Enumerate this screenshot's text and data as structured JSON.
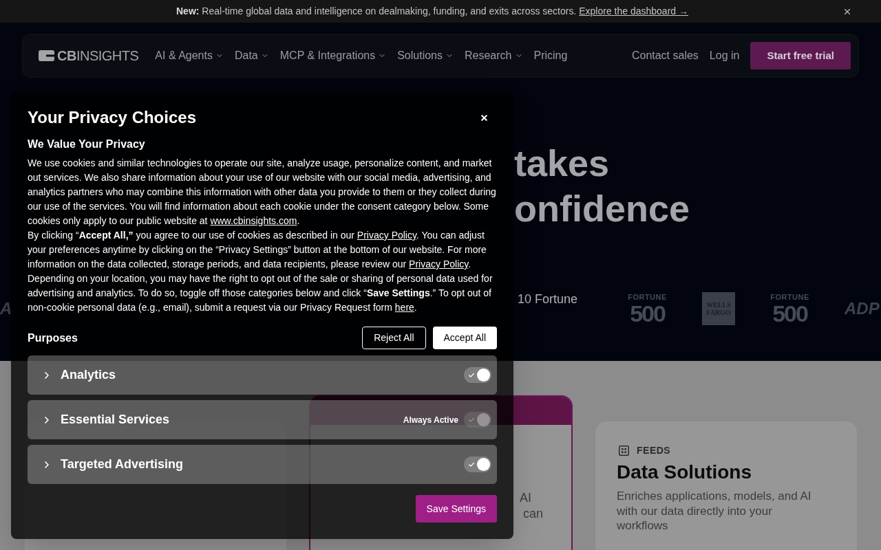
{
  "announcement": {
    "text": "**New:** Real-time global data and intelligence on dealmaking, funding, and exits across sectors.",
    "link": "Explore the dashboard →"
  },
  "nav": {
    "logo": "**CB**INSIGHTS",
    "items": [
      {
        "label": "AI & Agents",
        "kind": "menu"
      },
      {
        "label": "Data",
        "kind": "menu"
      },
      {
        "label": "MCP & Integrations",
        "kind": "menu"
      },
      {
        "label": "Solutions",
        "kind": "menu"
      },
      {
        "label": "Research",
        "kind": "menu"
      },
      {
        "label": "Pricing",
        "kind": "link"
      }
    ],
    "actions": [
      {
        "label": "Contact sales",
        "kind": "link"
      },
      {
        "label": "Log in",
        "kind": "link"
      },
      {
        "label": "Start free trial",
        "kind": "primary"
      }
    ]
  },
  "hero": {
    "heading_fragments": [
      "takes",
      "onfidence"
    ],
    "caption_fragment": "10 Fortune",
    "logos": [
      {
        "kind": "adp",
        "lines": [
          "A"
        ]
      },
      {
        "kind": "fortune",
        "lines": [
          "FORTUNE",
          "500"
        ]
      },
      {
        "kind": "wells_fargo",
        "lines": [
          "WELLS",
          "FARGO"
        ]
      },
      {
        "kind": "fortune",
        "lines": [
          "FORTUNE",
          "500"
        ]
      },
      {
        "kind": "adp",
        "lines": [
          "ADP"
        ]
      }
    ]
  },
  "cards": [
    {
      "kind": "standard"
    },
    {
      "kind": "featured",
      "text_fragments": [
        "AI",
        "can"
      ]
    },
    {
      "kind": "standard",
      "eyebrow": "FEEDS",
      "title": "Data Solutions",
      "description": "Enriches applications, models, and AI with our data directly into your workflows"
    }
  ],
  "privacy_dialog": {
    "title": "Your Privacy Choices",
    "subtitle": "We Value Your Privacy",
    "paragraphs": [
      [
        {
          "kind": "text",
          "text": "We use cookies and similar technologies to operate our site, analyze usage, personalize content, and market out services. We also share information about your use of our website with our social media, advertising, and analytics partners who may combine this information with other data you provide to them or they collect during our use of the services. You will find information about each cookie under the consent category below. Some cookies only apply to our public website at "
        },
        {
          "kind": "link",
          "text": "www.cbinsights.com"
        },
        {
          "kind": "text",
          "text": "."
        }
      ],
      [
        {
          "kind": "text",
          "text": "By clicking “**Accept All,”** you agree to our use of cookies as described in our "
        },
        {
          "kind": "link",
          "text": "Privacy Policy"
        },
        {
          "kind": "text",
          "text": ". You can adjust your preferences anytime by clicking on the “Privacy Settings” button at the bottom of our website. For more information on the data collected, storage periods, and data recipients, please review our "
        },
        {
          "kind": "link",
          "text": "Privacy Policy"
        },
        {
          "kind": "text",
          "text": ". Depending on your location, you may have the right to opt out of the sale or sharing of personal data used for advertising and analytics. To do so, toggle off those categories below and click “**Save Settings**.” To opt out of non-cookie personal data (e.g., email), submit a request via our Privacy Request form "
        },
        {
          "kind": "link",
          "text": "here"
        },
        {
          "kind": "text",
          "text": "."
        }
      ]
    ],
    "purposes_heading": "Purposes",
    "buttons": [
      {
        "label": "Reject All",
        "kind": "outline"
      },
      {
        "label": "Accept All",
        "kind": "solid"
      }
    ],
    "purposes": [
      {
        "label": "Analytics",
        "expanded": false,
        "on": true,
        "disabled": false
      },
      {
        "label": "Essential Services",
        "expanded": false,
        "on": true,
        "disabled": true,
        "note": "Always Active"
      },
      {
        "label": "Targeted Advertising",
        "expanded": false,
        "on": true,
        "disabled": false
      }
    ],
    "save_button": "Save Settings"
  }
}
